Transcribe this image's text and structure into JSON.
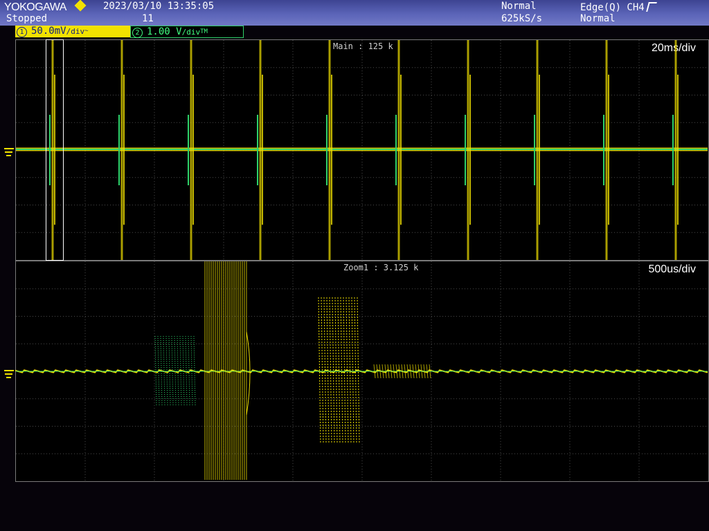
{
  "header": {
    "brand": "YOKOGAWA",
    "status": "Stopped",
    "timestamp": "2023/03/10 13:35:05",
    "acq_count": "11",
    "acq_mode": "Normal",
    "sample_rate": "625kS/s",
    "trigger": "Edge(Q) CH4",
    "trigger_mode": "Normal"
  },
  "channels": [
    {
      "num": "1",
      "scale": "50.0mV",
      "unit": "/div",
      "coupling": "~",
      "color": "#f2e200"
    },
    {
      "num": "2",
      "scale": "1.00 V",
      "unit": "/div",
      "coupling": "TM",
      "color": "#2fd26a"
    }
  ],
  "main_window": {
    "label": "Main : 125 k",
    "timebase": "20ms/div"
  },
  "zoom_window": {
    "label": "Zoom1 : 3.125 k",
    "timebase": "500us/div"
  },
  "colors": {
    "ch1": "#f2e200",
    "ch2": "#2fd26a",
    "header": "#5b64b8",
    "grid": "#4a4a4a"
  }
}
